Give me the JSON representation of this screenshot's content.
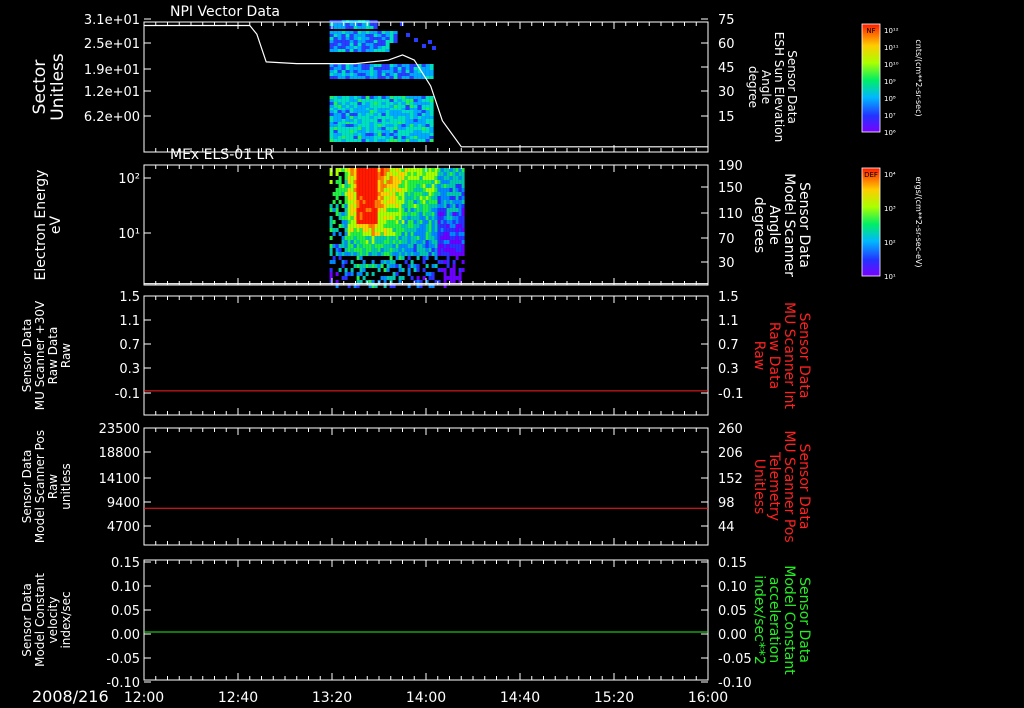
{
  "date_label": "2008/216",
  "colors": {
    "frame": "#ffffff",
    "line_white": "#ffffff",
    "line_red": "#ff2020",
    "line_green": "#22ee22",
    "label_red": "#ff2020",
    "label_green": "#22ee22"
  },
  "time_axis": {
    "start_min": 720,
    "end_min": 960,
    "tick_labels": [
      "12:00",
      "12:40",
      "13:20",
      "14:00",
      "14:40",
      "15:20",
      "16:00"
    ]
  },
  "colorbars": [
    {
      "title": "NF",
      "unit": "cnts/(cm**2-sr-sec)",
      "ticks": [
        "10¹²",
        "10¹¹",
        "10¹⁰",
        "10⁹",
        "10⁸",
        "10⁷",
        "10⁶"
      ]
    },
    {
      "title": "DEF",
      "unit": "ergs/(cm**2-sr-sec-eV)",
      "ticks": [
        "10⁴",
        "10³",
        "10²",
        "10¹"
      ]
    }
  ],
  "chart_data": [
    {
      "type": "heatmap",
      "title": "NPI Vector Data",
      "ylabel_left": [
        "Sector",
        "Unitless"
      ],
      "ylabel_right": [
        "Sensor Data",
        "ESH Sun Elevation",
        "Angle",
        "degree"
      ],
      "left_ticks": [
        "3.1e+01",
        "2.5e+01",
        "1.9e+01",
        "1.2e+01",
        "6.2e+00"
      ],
      "right_ticks": [
        "75",
        "60",
        "45",
        "30",
        "15"
      ],
      "right_ylim": [
        0,
        75
      ],
      "heatmap_x_range": [
        "13:19",
        "14:03"
      ],
      "overlay_line": {
        "name": "ESH Sun Elevation Angle",
        "x": [
          "12:00",
          "12:45",
          "12:48",
          "12:52",
          "13:05",
          "13:30",
          "13:44",
          "13:50",
          "13:55",
          "14:02",
          "14:07",
          "14:15",
          "16:00"
        ],
        "y": [
          73,
          73,
          68,
          52,
          51,
          51,
          53,
          56,
          53,
          38,
          18,
          3,
          3
        ]
      }
    },
    {
      "type": "heatmap",
      "title": "MEx ELS-01 LR",
      "ylabel_left": [
        "Electron Energy",
        "eV"
      ],
      "ylabel_right": [
        "Sensor Data",
        "Model Scanner",
        "Angle",
        "degrees"
      ],
      "left_ticks": [
        "10²",
        "10¹"
      ],
      "right_ticks": [
        "190",
        "150",
        "110",
        "70",
        "30"
      ],
      "right_ylim": [
        0,
        190
      ],
      "heatmap_x_range": [
        "13:19",
        "14:16"
      ],
      "overlay_line": {
        "name": "Model Scanner Angle",
        "x": [
          "12:00",
          "16:00"
        ],
        "y": [
          2,
          2
        ]
      }
    },
    {
      "type": "line",
      "ylabel_left": [
        "Sensor Data",
        "MU Scanner +30V",
        "Raw Data",
        "Raw"
      ],
      "ylabel_right": [
        "Sensor Data",
        "MU Scanner Int",
        "Raw Data",
        "Raw"
      ],
      "left_ticks": [
        "1.5",
        "1.1",
        "0.7",
        "0.3",
        "-0.1"
      ],
      "right_ticks": [
        "1.5",
        "1.1",
        "0.7",
        "0.3",
        "-0.1"
      ],
      "ylim": [
        -0.38,
        1.5
      ],
      "series": [
        {
          "x": [
            "12:00",
            "16:00"
          ],
          "values": [
            0.0,
            0.0
          ]
        }
      ]
    },
    {
      "type": "line",
      "ylabel_left": [
        "Sensor Data",
        "Model Scanner Pos",
        "Raw",
        "unitless"
      ],
      "ylabel_right": [
        "Sensor Data",
        "MU Scanner Pos",
        "Telemetry",
        "Unitless"
      ],
      "left_ticks": [
        "23500",
        "18800",
        "14100",
        "9400",
        "4700"
      ],
      "right_ticks": [
        "260",
        "206",
        "152",
        "98",
        "44"
      ],
      "ylim": [
        0,
        23500
      ],
      "series": [
        {
          "x": [
            "12:00",
            "16:00"
          ],
          "values": [
            7400,
            7400
          ]
        }
      ]
    },
    {
      "type": "line",
      "ylabel_left": [
        "Sensor Data",
        "Model Constant",
        "velocity",
        "index/sec"
      ],
      "ylabel_right": [
        "Sensor Data",
        "Model Constant",
        "acceleration",
        "index/sec**2"
      ],
      "left_ticks": [
        "0.15",
        "0.10",
        "0.05",
        "0.00",
        "-0.05",
        "-0.10"
      ],
      "right_ticks": [
        "0.15",
        "0.10",
        "0.05",
        "0.00",
        "-0.05",
        "-0.10"
      ],
      "ylim": [
        -0.1,
        0.15
      ],
      "series": [
        {
          "x": [
            "12:00",
            "16:00"
          ],
          "values": [
            0.0,
            0.0
          ]
        }
      ]
    }
  ]
}
